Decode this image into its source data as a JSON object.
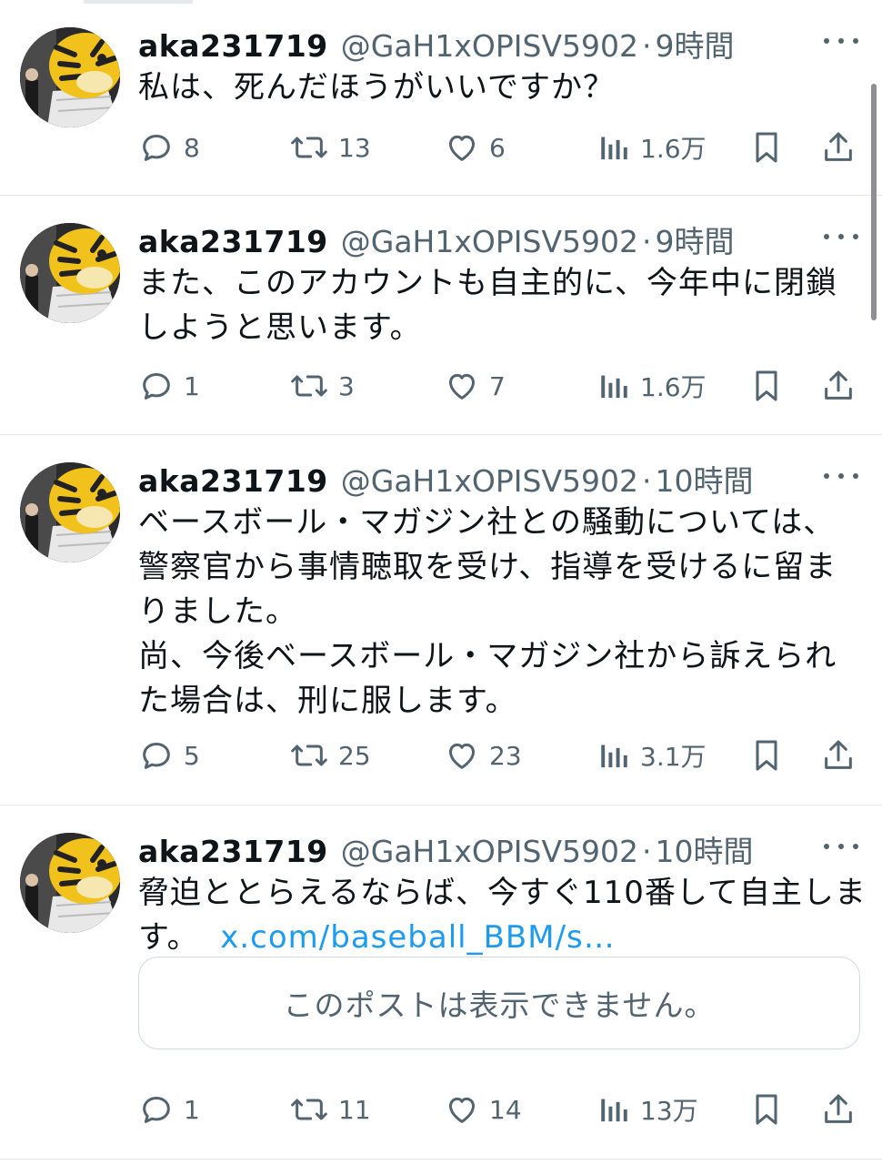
{
  "tweets": [
    {
      "name": "aka231719",
      "handle": "@GaH1xOPISV5902",
      "sep": "·",
      "time": "9時間",
      "lines": [
        "私は、死んだほうがいいですか？"
      ],
      "replies": "8",
      "retweets": "13",
      "likes": "6",
      "views": "1.6万"
    },
    {
      "name": "aka231719",
      "handle": "@GaH1xOPISV5902",
      "sep": "·",
      "time": "9時間",
      "lines": [
        "また、このアカウントも自主的に、今年中に閉鎖",
        "しようと思います。"
      ],
      "replies": "1",
      "retweets": "3",
      "likes": "7",
      "views": "1.6万"
    },
    {
      "name": "aka231719",
      "handle": "@GaH1xOPISV5902",
      "sep": "·",
      "time": "10時間",
      "lines": [
        "ベースボール・マガジン社との騒動については、",
        "警察官から事情聴取を受け、指導を受けるに留ま",
        "りました。",
        "尚、今後ベースボール・マガジン社から訴えられ",
        "た場合は、刑に服します。"
      ],
      "replies": "5",
      "retweets": "25",
      "likes": "23",
      "views": "3.1万"
    },
    {
      "name": "aka231719",
      "handle": "@GaH1xOPISV5902",
      "sep": "·",
      "time": "10時間",
      "lines": [
        "脅迫ととらえるならば、今すぐ110番して自主しま",
        "す。"
      ],
      "link": "x.com/baseball_BBM/s…",
      "quote": "このポストは表示できません。",
      "replies": "1",
      "retweets": "11",
      "likes": "14",
      "views": "13万"
    }
  ],
  "icons": {
    "reply": "reply-icon",
    "retweet": "retweet-icon",
    "like": "like-icon",
    "views": "views-icon",
    "bookmark": "bookmark-icon",
    "share": "share-icon",
    "more": "more-icon"
  },
  "colors": {
    "text": "#0f1419",
    "secondary": "#536471",
    "link": "#1d9bf0",
    "divider": "#e6e9ec"
  }
}
